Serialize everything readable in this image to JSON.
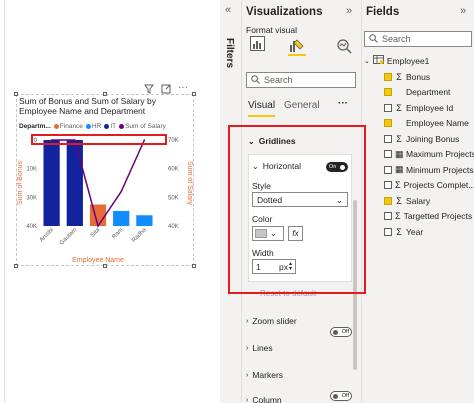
{
  "canvas": {
    "chart_title": "Sum of Bonus and Sum of Salary by Employee Name and Department",
    "header_icons": [
      "filter-icon",
      "expand-icon",
      "more-icon"
    ]
  },
  "chart_data": {
    "type": "bar",
    "legend_title": "Departm...",
    "legend": [
      {
        "name": "Finance",
        "color": "#e66c37"
      },
      {
        "name": "HR",
        "color": "#118dff"
      },
      {
        "name": "IT",
        "color": "#12239e"
      },
      {
        "name": "Sum of Salary",
        "color": "#6b007b"
      }
    ],
    "categories": [
      "Arushi",
      "Gautam",
      "Sita",
      "Ram",
      "Radha"
    ],
    "bars": [
      {
        "category": "Arushi",
        "value": 20,
        "dept": "IT"
      },
      {
        "category": "Gautam",
        "value": 20,
        "dept": "IT"
      },
      {
        "category": "Sita",
        "value": 5,
        "dept": "Finance"
      },
      {
        "category": "Ram",
        "value": 3.5,
        "dept": "HR"
      },
      {
        "category": "Radha",
        "value": 2.5,
        "dept": "HR"
      }
    ],
    "line_series": {
      "name": "Sum of Salary",
      "values": [
        70000,
        70000,
        40000,
        52000,
        70000
      ]
    },
    "y_left": {
      "label": "Sum of Bonus",
      "ticks": [
        "20",
        "10K",
        "30K",
        "40K"
      ],
      "range": [
        0,
        20
      ]
    },
    "y_right": {
      "label": "Sum of Salary",
      "ticks": [
        "70K",
        "60K",
        "50K",
        "40K"
      ],
      "range": [
        40000,
        70000
      ]
    },
    "xlabel": "Employee Name"
  },
  "filters": {
    "label": "Filters"
  },
  "visualizations": {
    "title": "Visualizations",
    "format_visual": "Format visual",
    "search_placeholder": "Search",
    "tabs": {
      "visual": "Visual",
      "general": "General",
      "more": "···"
    },
    "gridlines": "Gridlines",
    "horizontal": "Horizontal",
    "horizontal_toggle": "On",
    "style_label": "Style",
    "style_value": "Dotted",
    "color_label": "Color",
    "fx": "fx",
    "width_label": "Width",
    "width_value": "1",
    "width_unit": "px",
    "reset": "Reset to default",
    "sections": [
      {
        "label": "Zoom slider",
        "toggle": "Off"
      },
      {
        "label": "Lines",
        "toggle": ""
      },
      {
        "label": "Markers",
        "toggle": "Off"
      },
      {
        "label": "Column",
        "toggle": ""
      }
    ]
  },
  "fields": {
    "title": "Fields",
    "search_placeholder": "Search",
    "table": "Employee1",
    "items": [
      {
        "label": "Bonus",
        "checked": true,
        "icon": "Σ"
      },
      {
        "label": "Department",
        "checked": true,
        "icon": ""
      },
      {
        "label": "Employee Id",
        "checked": false,
        "icon": "Σ"
      },
      {
        "label": "Employee Name",
        "checked": true,
        "icon": ""
      },
      {
        "label": "Joining Bonus",
        "checked": false,
        "icon": "Σ"
      },
      {
        "label": "Maximum Projects",
        "checked": false,
        "icon": "▦"
      },
      {
        "label": "Minimum Projects",
        "checked": false,
        "icon": "▦"
      },
      {
        "label": "Projects Complet...",
        "checked": false,
        "icon": "Σ"
      },
      {
        "label": "Salary",
        "checked": true,
        "icon": "Σ"
      },
      {
        "label": "Targetted Projects",
        "checked": false,
        "icon": "Σ"
      },
      {
        "label": "Year",
        "checked": false,
        "icon": "Σ"
      }
    ]
  }
}
